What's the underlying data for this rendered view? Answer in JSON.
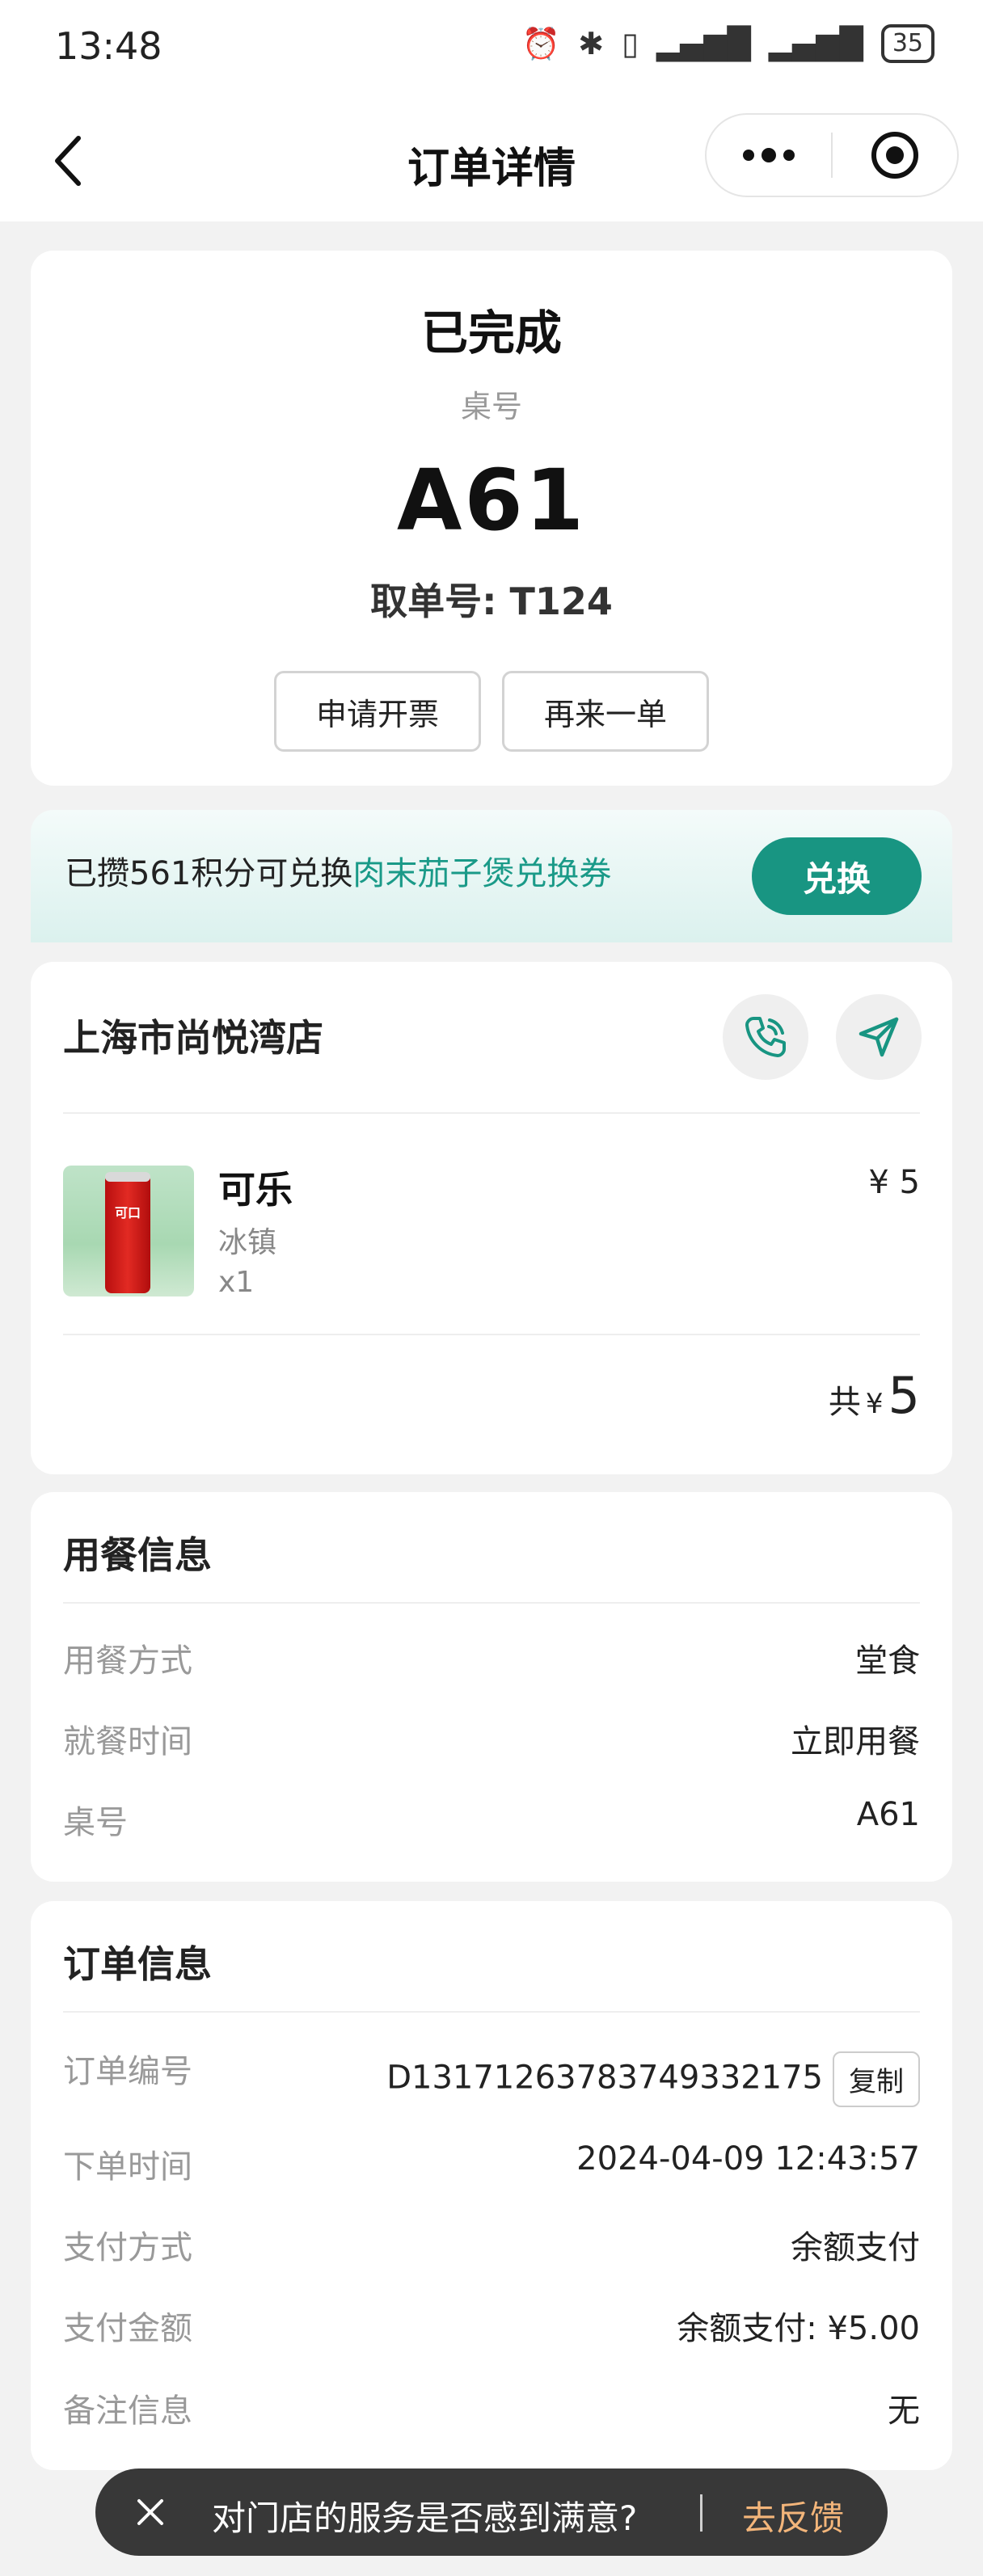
{
  "status_bar": {
    "time": "13:48",
    "battery": "35"
  },
  "nav": {
    "title": "订单详情"
  },
  "order_status": {
    "status": "已完成",
    "table_label": "桌号",
    "table_number": "A61",
    "pickup": "取单号: T124",
    "invoice_button": "申请开票",
    "reorder_button": "再来一单"
  },
  "points_banner": {
    "prefix": "已攒561积分可兑换",
    "highlight": "肉末茄子煲兑换券",
    "button": "兑换",
    "accent_color": "#189582"
  },
  "store": {
    "name": "上海市尚悦湾店",
    "items": [
      {
        "name": "可乐",
        "spec": "冰镇",
        "qty": "x1",
        "price": "¥ 5"
      }
    ],
    "total_label": "共",
    "total_currency": "¥",
    "total_value": "5"
  },
  "dining_info": {
    "title": "用餐信息",
    "rows": [
      {
        "label": "用餐方式",
        "value": "堂食"
      },
      {
        "label": "就餐时间",
        "value": "立即用餐"
      },
      {
        "label": "桌号",
        "value": "A61"
      }
    ]
  },
  "order_info": {
    "title": "订单信息",
    "copy_label": "复制",
    "rows": [
      {
        "label": "订单编号",
        "value": "D13171263783749332175"
      },
      {
        "label": "下单时间",
        "value": "2024-04-09 12:43:57"
      },
      {
        "label": "支付方式",
        "value": "余额支付"
      },
      {
        "label": "支付金额",
        "value": "余额支付: ¥5.00"
      },
      {
        "label": "备注信息",
        "value": "无"
      }
    ]
  },
  "feedback": {
    "question": "对门店的服务是否感到满意?",
    "link": "去反馈"
  }
}
